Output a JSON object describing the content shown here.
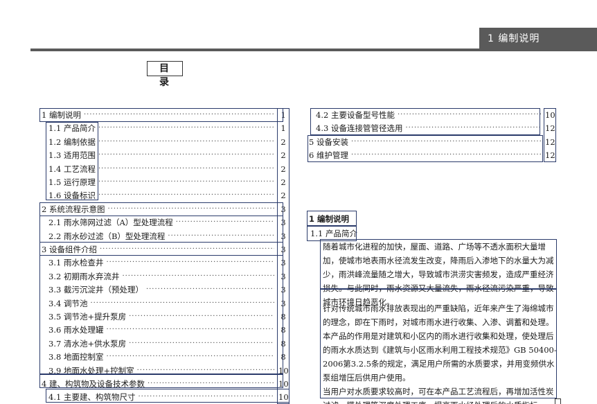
{
  "header": {
    "section_tab": "1 编制说明"
  },
  "toc": {
    "title": "目  录",
    "left_entries": [
      {
        "label": "1 编制说明",
        "page": "1"
      },
      {
        "label": "1.1 产品简介",
        "page": "1"
      },
      {
        "label": "1.2 编制依据",
        "page": "2"
      },
      {
        "label": "1.3 适用范围",
        "page": "2"
      },
      {
        "label": "1.4 工艺流程",
        "page": "2"
      },
      {
        "label": "1.5 运行原理",
        "page": "2"
      },
      {
        "label": "1.6 设备标识",
        "page": "2"
      },
      {
        "label": "2 系统流程示意图",
        "page": "3"
      },
      {
        "label": "2.1 雨水筛网过滤（A）型处理流程",
        "page": "3"
      },
      {
        "label": "2.2 雨水砂过滤（B）型处理流程",
        "page": "3"
      },
      {
        "label": "3 设备组件介绍",
        "page": "3"
      },
      {
        "label": "3.1 雨水检查井",
        "page": "3"
      },
      {
        "label": "3.2 初期雨水弃流井",
        "page": "3"
      },
      {
        "label": "3.3 截污沉淀井（预处理）",
        "page": "3"
      },
      {
        "label": "3.4 调节池",
        "page": "3"
      },
      {
        "label": "3.5 调节池+提升泵房",
        "page": "8"
      },
      {
        "label": "3.6 雨水处理罐",
        "page": "8"
      },
      {
        "label": "3.7 清水池+供水泵房",
        "page": "8"
      },
      {
        "label": "3.8 地面控制室",
        "page": "8"
      },
      {
        "label": "3.9 地面水处理+控制室",
        "page": "10"
      },
      {
        "label": "4 建、构筑物及设备技术参数",
        "page": "10"
      },
      {
        "label": "4.1 主要建、构筑物尺寸",
        "page": "10"
      }
    ],
    "right_entries": [
      {
        "label": "4.2 主要设备型号性能",
        "page": "10"
      },
      {
        "label": "4.3 设备连接管管径选用",
        "page": "12"
      },
      {
        "label": "5 设备安装",
        "page": "12"
      },
      {
        "label": "6 维护管理",
        "page": "12"
      }
    ]
  },
  "section": {
    "heading": "1 编制说明",
    "subheading": "1.1  产品简介",
    "paragraph1": "随着城市化进程的加快，屋面、道路、广场等不透水面积大量增加，使城市地表雨水径流发生改变，降雨后入渗地下的水量大为减少，雨洪峰流量随之增大，导致城市洪涝灾害频发，造成严重经济损失。与此同时，雨水资源又大量流失，雨水径流污染严重，导致城市环境日趋恶化。",
    "paragraph2": "针对传统城市雨水排放表现出的严重缺陷，近年来产生了海绵城市的理念，即在下雨时，对城市雨水进行收集、入渗、调蓄和处理。本产品的作用是对建筑和小区内的雨水进行收集和处理，使处理后的雨水水质达到《建筑与小区雨水利用工程技术规范》GB 50400-2006第3.2.5条的规定，满足用户所需的水质要求，并用变频供水泵组增压后供用户使用。",
    "paragraph3": "当用户对水质要求较高时，可在本产品工艺流程后，再增加活性炭过滤、膜处理等深度处理工序，提高雨水经处理后的水质指标。"
  }
}
